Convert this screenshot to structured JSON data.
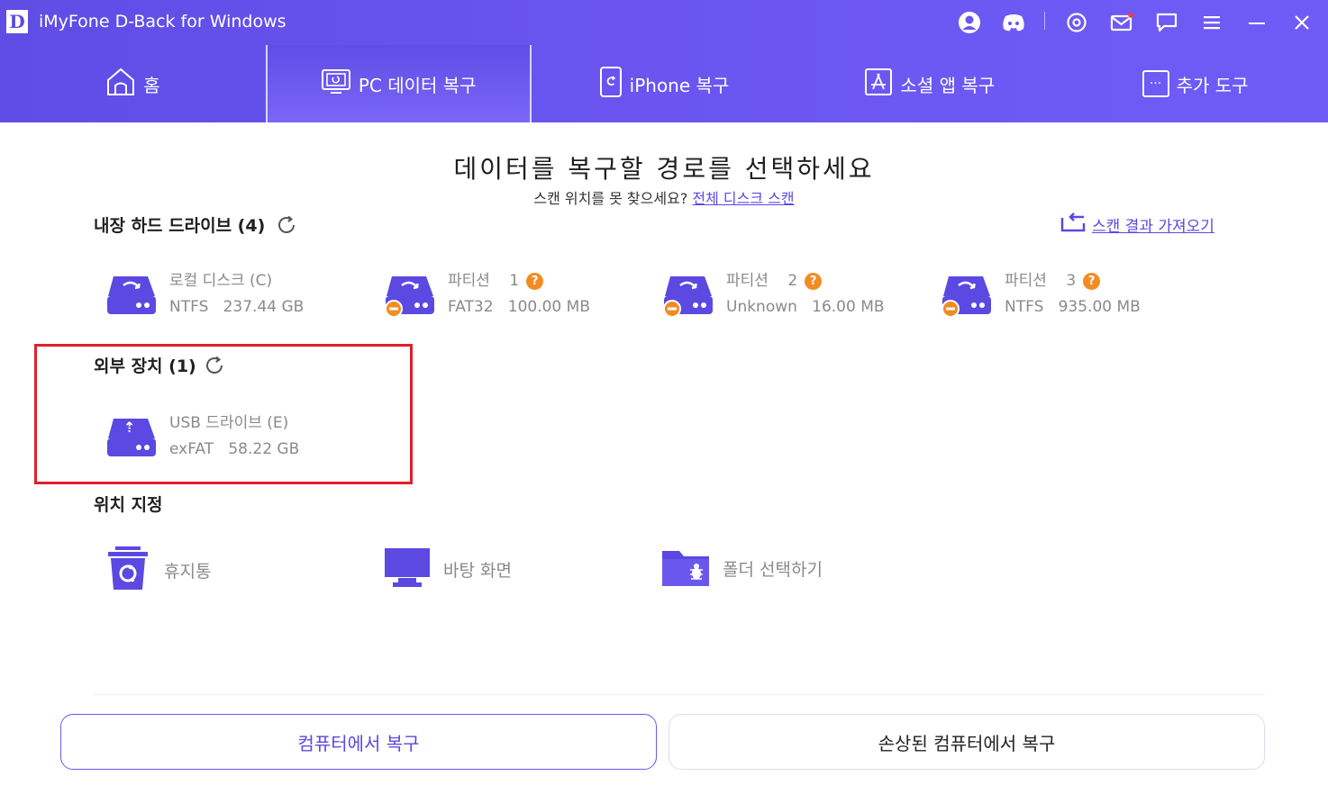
{
  "app": {
    "logo_letter": "D",
    "title": "iMyFone D-Back for Windows"
  },
  "titlebar_icons": [
    "user-icon",
    "discord-icon",
    "settings-icon",
    "mail-icon",
    "feedback-icon",
    "menu-icon",
    "minimize-icon",
    "close-icon"
  ],
  "nav": {
    "tabs": [
      {
        "label": "홈",
        "icon": "home-icon"
      },
      {
        "label": "PC 데이터 복구",
        "icon": "pc-recovery-icon",
        "active": true
      },
      {
        "label": "iPhone 복구",
        "icon": "iphone-icon"
      },
      {
        "label": "소셜 앱 복구",
        "icon": "app-store-icon"
      },
      {
        "label": "추가 도구",
        "icon": "more-tools-icon"
      }
    ]
  },
  "main": {
    "title": "데이터를 복구할 경로를 선택하세요",
    "subtitle_prefix": "스캔 위치를 못 찾으세요?",
    "subtitle_link": "전체 디스크 스캔",
    "import_scan": "스캔 결과 가져오기"
  },
  "internal": {
    "title": "내장 하드 드라이브 (4)",
    "drives": [
      {
        "name": "로컬 디스크 (C)",
        "fs": "NTFS",
        "size": "237.44 GB",
        "question": false,
        "badge": false
      },
      {
        "name": "파티션",
        "num": "1",
        "fs": "FAT32",
        "size": "100.00 MB",
        "question": true,
        "badge": true
      },
      {
        "name": "파티션",
        "num": "2",
        "fs": "Unknown",
        "size": "16.00 MB",
        "question": true,
        "badge": true
      },
      {
        "name": "파티션",
        "num": "3",
        "fs": "NTFS",
        "size": "935.00 MB",
        "question": true,
        "badge": true
      }
    ]
  },
  "external": {
    "title": "외부 장치 (1)",
    "drives": [
      {
        "name": "USB 드라이브 (E)",
        "fs": "exFAT",
        "size": "58.22 GB"
      }
    ]
  },
  "locations": {
    "title": "위치 지정",
    "items": [
      {
        "label": "휴지통",
        "icon": "recycle-bin-icon"
      },
      {
        "label": "바탕 화면",
        "icon": "desktop-icon"
      },
      {
        "label": "폴더 선택하기",
        "icon": "folder-icon"
      }
    ]
  },
  "question_mark": "?",
  "usb_symbol": "⇡",
  "tools_dots": "···",
  "buttons": {
    "primary": "컴퓨터에서 복구",
    "secondary": "손상된 컴퓨터에서 복구"
  },
  "colors": {
    "accent": "#5b49e2",
    "header": "#6a55f0",
    "highlight": "#e21f2b",
    "badge": "#f28c22"
  }
}
